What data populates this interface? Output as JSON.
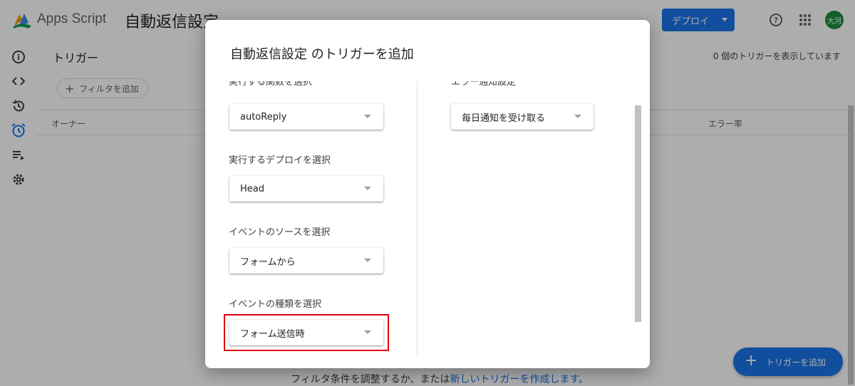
{
  "header": {
    "app_name": "Apps Script",
    "project_title": "自動返信設定",
    "deploy_label": "デプロイ",
    "help_glyph": "?",
    "avatar_text": "大河"
  },
  "sidebar": {
    "items": [
      {
        "name": "overview",
        "icon": "info-icon"
      },
      {
        "name": "editor",
        "icon": "code-icon"
      },
      {
        "name": "executions-history",
        "icon": "history-icon"
      },
      {
        "name": "triggers",
        "icon": "alarm-icon"
      },
      {
        "name": "executions",
        "icon": "playlist-icon"
      },
      {
        "name": "settings",
        "icon": "gear-icon"
      }
    ]
  },
  "content": {
    "title": "トリガー",
    "count_text": "0 個のトリガーを表示しています",
    "filter_label": "フィルタを追加",
    "columns": {
      "owner": "オーナー",
      "error_rate": "エラー率"
    },
    "empty_text": "フィルタ条件を調整するか、または",
    "empty_link": "新しいトリガーを作成します。"
  },
  "fab": {
    "label": "トリガーを追加"
  },
  "dialog": {
    "title": "自動返信設定 のトリガーを追加",
    "cut_label_left": "実行する関数を選択",
    "cut_label_right": "エラー通知設定",
    "function_value": "autoReply",
    "deploy_label": "実行するデプロイを選択",
    "deploy_value": "Head",
    "event_source_label": "イベントのソースを選択",
    "event_source_value": "フォームから",
    "event_type_label": "イベントの種類を選択",
    "event_type_value": "フォーム送信時",
    "notification_value": "毎日通知を受け取る"
  },
  "colors": {
    "accent": "#1a73e8",
    "highlight_border": "#e0000f",
    "avatar_bg": "#1e8e3e",
    "active_icon": "#1a73e8"
  }
}
